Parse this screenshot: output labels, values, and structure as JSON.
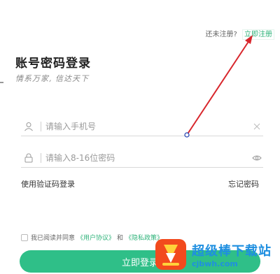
{
  "header": {
    "no_account_text": "还未注册?",
    "register_link": "立即注册"
  },
  "login": {
    "title": "账号密码登录",
    "slogan": "情系万家, 信达天下"
  },
  "phone": {
    "placeholder": "请输入手机号"
  },
  "password": {
    "placeholder": "请输入8-16位密码"
  },
  "links": {
    "code_login": "使用验证码登录",
    "forgot": "忘记密码"
  },
  "agreement": {
    "prefix": "我已阅读并同意",
    "user_agreement": "《用户协议》",
    "and": "和",
    "privacy": "《隐私政策》"
  },
  "button": {
    "login": "立即登录"
  },
  "watermark": {
    "name": "超级棒下载站",
    "url": "cjbwh.com"
  },
  "colors": {
    "accent": "#2fbf88",
    "annotation": "#d8262c",
    "watermark": "#1f8fe0"
  }
}
